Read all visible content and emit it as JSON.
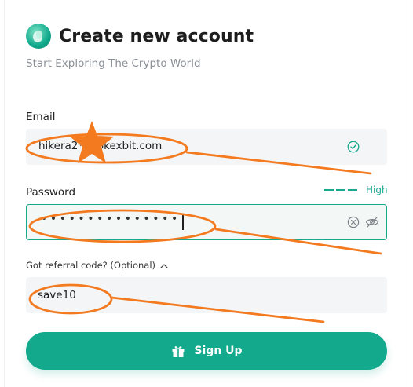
{
  "header": {
    "title": "Create new account",
    "subtitle": "Start Exploring The Crypto World"
  },
  "email": {
    "label": "Email",
    "value": "hikera2*** okexbit.com",
    "valid_icon": "check-circle-icon"
  },
  "password": {
    "label": "Password",
    "masked_value": "•••••••••••••••",
    "strength_text": "High",
    "clear_icon": "clear-icon",
    "visibility_icon": "eye-off-icon"
  },
  "referral": {
    "toggle_label": "Got referral code? (Optional)",
    "toggle_icon": "chevron-up-icon",
    "value": "save10"
  },
  "signup": {
    "label": "Sign Up",
    "icon": "gift-icon"
  },
  "colors": {
    "brand": "#12a98c",
    "annotation": "#f47a20"
  }
}
